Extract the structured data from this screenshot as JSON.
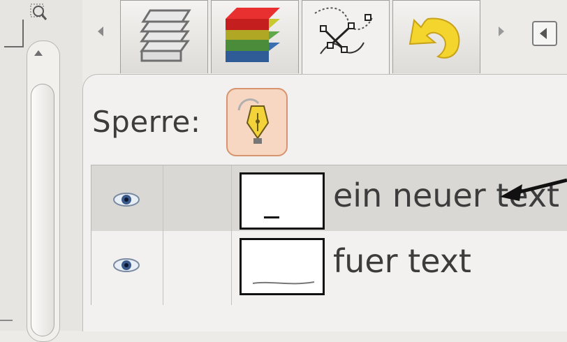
{
  "toolbar": {
    "left_corner_icon": "corner-bracket-icon",
    "zoom_icon": "zoom-fit-icon"
  },
  "tabs": [
    {
      "name": "layers-tab",
      "icon": "layers-stack-icon"
    },
    {
      "name": "channels-tab",
      "icon": "rgb-channels-icon"
    },
    {
      "name": "paths-tab",
      "icon": "paths-icon",
      "active": true
    },
    {
      "name": "undo-history-tab",
      "icon": "undo-icon"
    }
  ],
  "lock": {
    "label": "Sperre:",
    "icon": "pen-nib-icon",
    "accent": "#d7946f"
  },
  "paths": [
    {
      "name": "ein neuer text",
      "visible": true,
      "selected": true
    },
    {
      "name": "fuer text",
      "visible": true,
      "selected": false
    }
  ]
}
